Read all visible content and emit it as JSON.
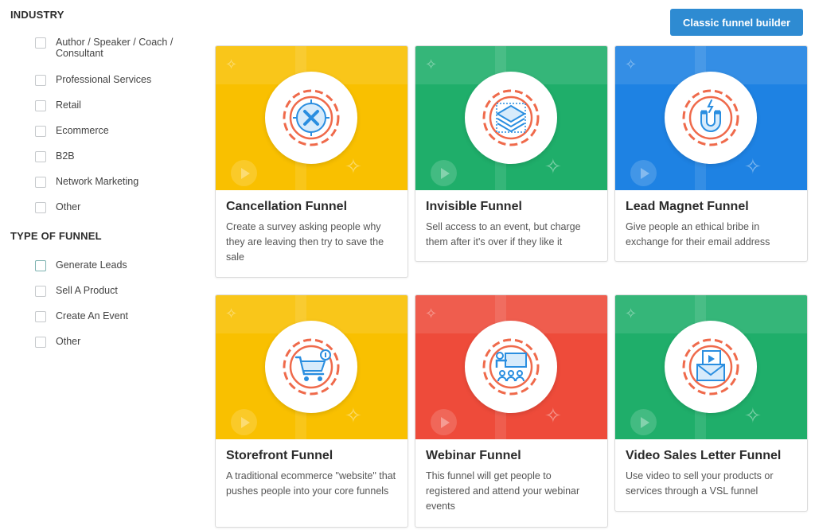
{
  "filters": {
    "industry": {
      "title": "INDUSTRY",
      "options": [
        {
          "label": "Author / Speaker / Coach / Consultant",
          "checked": false
        },
        {
          "label": "Professional Services",
          "checked": false
        },
        {
          "label": "Retail",
          "checked": false
        },
        {
          "label": "Ecommerce",
          "checked": false
        },
        {
          "label": "B2B",
          "checked": false
        },
        {
          "label": "Network Marketing",
          "checked": false
        },
        {
          "label": "Other",
          "checked": false
        }
      ]
    },
    "funnel_type": {
      "title": "TYPE OF FUNNEL",
      "options": [
        {
          "label": "Generate Leads",
          "checked": false
        },
        {
          "label": "Sell A Product",
          "checked": false
        },
        {
          "label": "Create An Event",
          "checked": false
        },
        {
          "label": "Other",
          "checked": false
        }
      ]
    }
  },
  "toolbar": {
    "classic_label": "Classic funnel builder"
  },
  "colors": {
    "yellow": "#f9c000",
    "green": "#1fae6a",
    "blue": "#1e82e3",
    "red": "#ee4b3a",
    "gear": "#ef6a4b",
    "icon": "#2a8ee0",
    "button": "#2e8bd2"
  },
  "cards": [
    {
      "title": "Cancellation Funnel",
      "desc": "Create a survey asking people why they are leaving then try to save the sale",
      "color": "#f9c000",
      "icon": "cancel-x-icon"
    },
    {
      "title": "Invisible Funnel",
      "desc": "Sell access to an event, but charge them after it's over if they like it",
      "color": "#1fae6a",
      "icon": "layers-icon"
    },
    {
      "title": "Lead Magnet Funnel",
      "desc": "Give people an ethical bribe in exchange for their email address",
      "color": "#1e82e3",
      "icon": "magnet-icon"
    },
    {
      "title": "Storefront Funnel",
      "desc": "A traditional ecommerce \"website\" that pushes people into your core funnels",
      "color": "#f9c000",
      "icon": "shopping-cart-icon"
    },
    {
      "title": "Webinar Funnel",
      "desc": "This funnel will get people to registered and attend your webinar events",
      "color": "#ee4b3a",
      "icon": "webinar-presenter-icon"
    },
    {
      "title": "Video Sales Letter Funnel",
      "desc": "Use video to sell your products or services through a VSL funnel",
      "color": "#1fae6a",
      "icon": "video-envelope-icon"
    }
  ]
}
